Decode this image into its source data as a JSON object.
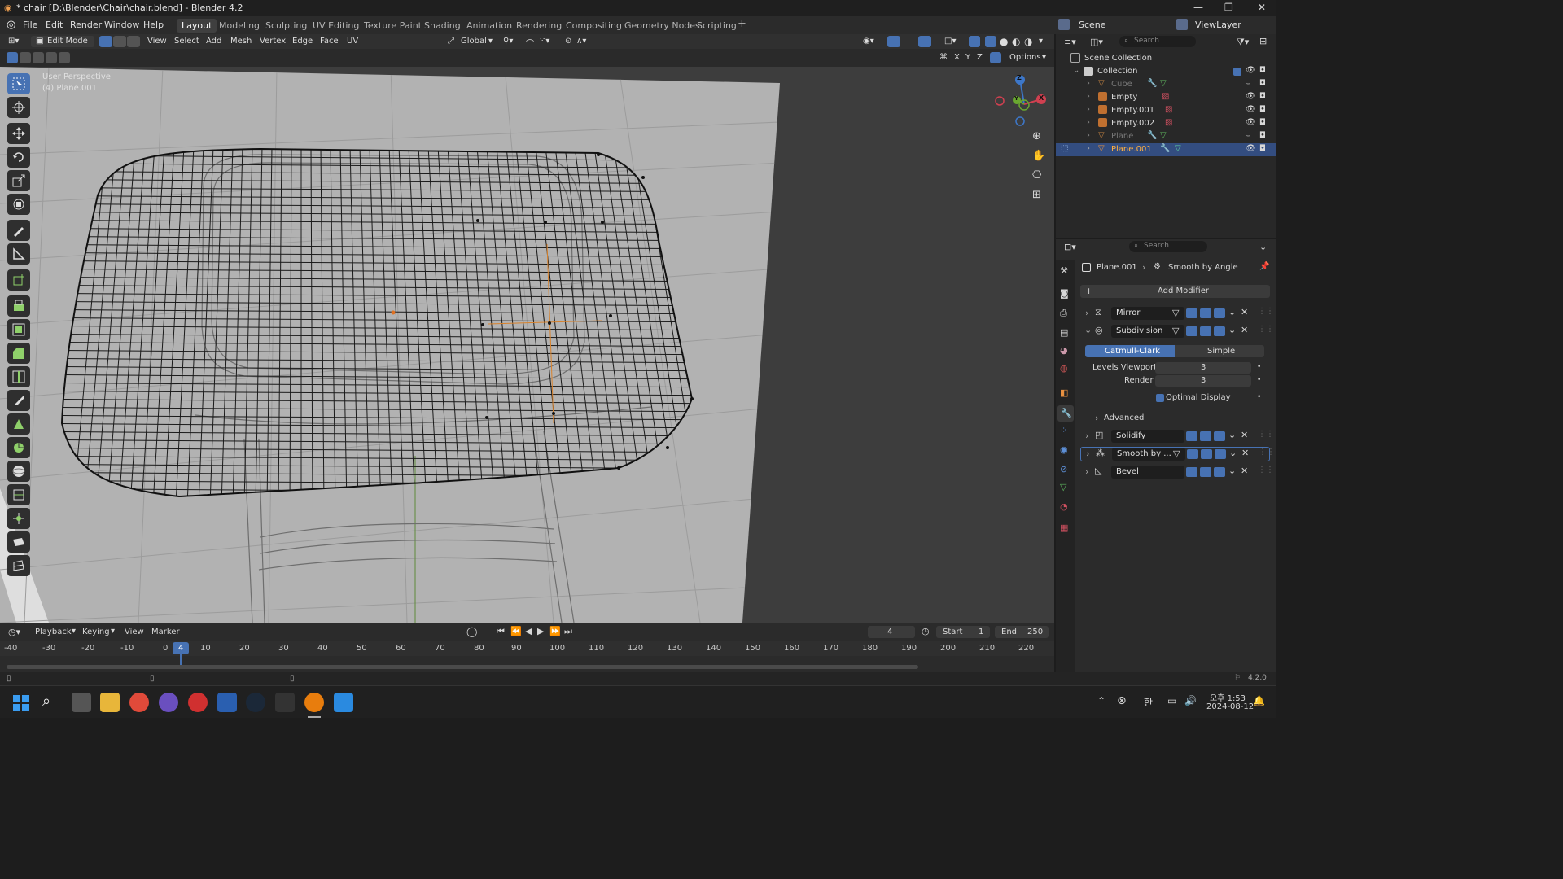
{
  "window": {
    "title": "* chair [D:\\Blender\\Chair\\chair.blend] - Blender 4.2",
    "minimize": "—",
    "restore": "❐",
    "close": "✕"
  },
  "menu": [
    "File",
    "Edit",
    "Render",
    "Window",
    "Help"
  ],
  "workspaces": [
    "Layout",
    "Modeling",
    "Sculpting",
    "UV Editing",
    "Texture Paint",
    "Shading",
    "Animation",
    "Rendering",
    "Compositing",
    "Geometry Nodes",
    "Scripting"
  ],
  "active_workspace": "Layout",
  "scene": {
    "label": "Scene",
    "view_layer": "ViewLayer"
  },
  "viewport_header": {
    "mode": "Edit Mode",
    "menus": [
      "View",
      "Select",
      "Add",
      "Mesh",
      "Vertex",
      "Edge",
      "Face",
      "UV"
    ],
    "orientation": "Global",
    "axes": [
      "X",
      "Y",
      "Z"
    ],
    "options": "Options"
  },
  "viewport": {
    "overlay_line1": "User Perspective",
    "overlay_line2": "(4) Plane.001",
    "gizmo": {
      "z": "Z",
      "y": "Y",
      "x": "X"
    }
  },
  "outliner": {
    "search_placeholder": "Search",
    "scene_collection": "Scene Collection",
    "collection": "Collection",
    "items": [
      {
        "name": "Cube",
        "dim": true,
        "selected": false
      },
      {
        "name": "Empty",
        "dim": false,
        "selected": false
      },
      {
        "name": "Empty.001",
        "dim": false,
        "selected": false
      },
      {
        "name": "Empty.002",
        "dim": false,
        "selected": false
      },
      {
        "name": "Plane",
        "dim": true,
        "selected": false
      },
      {
        "name": "Plane.001",
        "dim": false,
        "selected": true
      }
    ]
  },
  "properties": {
    "search_placeholder": "Search",
    "object": "Plane.001",
    "modifier_crumb": "Smooth by Angle",
    "add_modifier": "Add Modifier",
    "modifiers": [
      "Mirror",
      "Subdivision",
      "Solidify",
      "Smooth by ...",
      "Bevel"
    ],
    "subdivision": {
      "type_active": "Catmull-Clark",
      "type_other": "Simple",
      "levels_viewport_label": "Levels Viewport",
      "levels_viewport": "3",
      "render_label": "Render",
      "render": "3",
      "optimal_display": "Optimal Display",
      "advanced": "Advanced"
    }
  },
  "timeline": {
    "menus": [
      "Playback",
      "Keying",
      "View",
      "Marker"
    ],
    "current_frame": "4",
    "start_label": "Start",
    "start": "1",
    "end_label": "End",
    "end": "250",
    "ticks": [
      "-40",
      "-30",
      "-20",
      "-10",
      "0",
      "10",
      "20",
      "30",
      "40",
      "50",
      "60",
      "70",
      "80",
      "90",
      "100",
      "110",
      "120",
      "130",
      "140",
      "150",
      "160",
      "170",
      "180",
      "190",
      "200",
      "210",
      "220"
    ],
    "playhead": "4"
  },
  "status": {
    "version": "4.2.0"
  },
  "taskbar": {
    "time": "오후 1:53",
    "date": "2024-08-12",
    "ime": "한"
  },
  "colors": {
    "accent": "#4772b3",
    "viewport_bg": "#3d3d3d",
    "floor": "#b0b0b0",
    "panel": "#2b2b2b"
  }
}
